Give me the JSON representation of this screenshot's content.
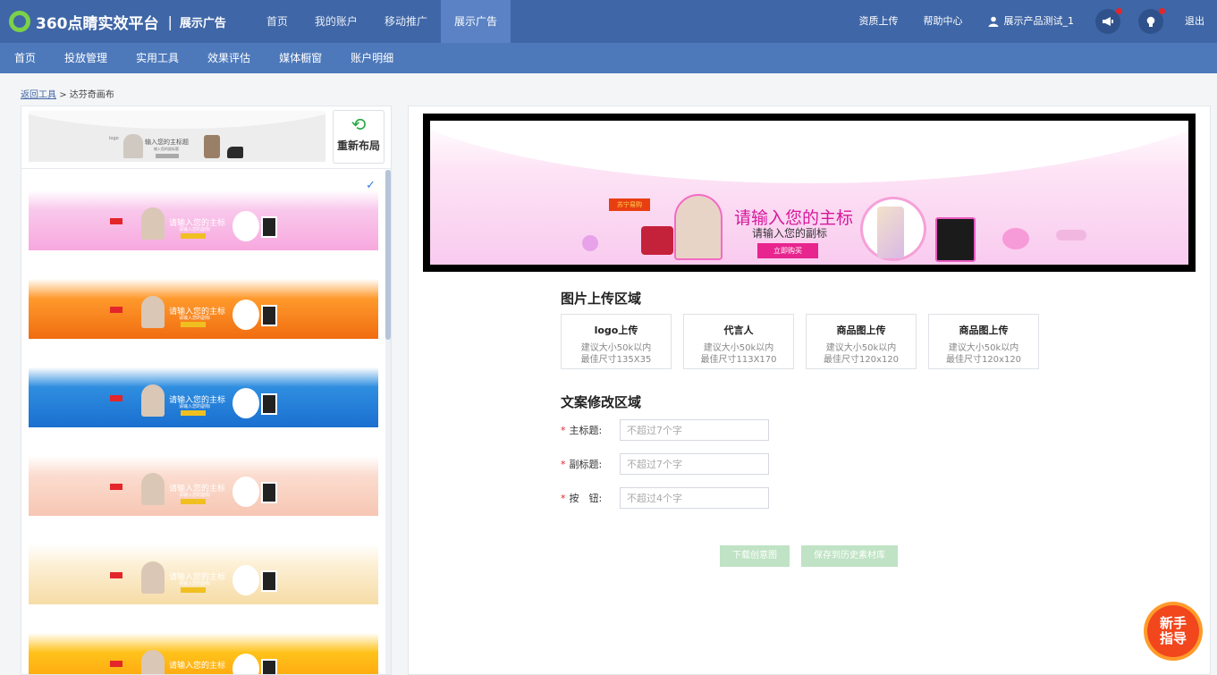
{
  "app": {
    "logo_text": "360点睛实效平台",
    "separator": "|",
    "section": "展示广告"
  },
  "top_nav": [
    {
      "label": "首页",
      "active": false
    },
    {
      "label": "我的账户",
      "active": false
    },
    {
      "label": "移动推广",
      "active": false
    },
    {
      "label": "展示广告",
      "active": true
    }
  ],
  "top_right": {
    "upload": "资质上传",
    "help": "帮助中心",
    "user": "展示产品测试_1",
    "logout": "退出"
  },
  "sub_nav": [
    "首页",
    "投放管理",
    "实用工具",
    "效果评估",
    "媒体橱窗",
    "账户明细"
  ],
  "breadcrumb": {
    "back": "返回工具",
    "sep": ">",
    "current": "达芬奇画布"
  },
  "left": {
    "preview": {
      "logo": "logo",
      "title": "输入您的主标题",
      "subtitle": "输入您的副标题"
    },
    "relayout_label": "重新布局",
    "templates": [
      {
        "title": "请输入您的主标",
        "subtitle": "请输入您的副标",
        "bg": "#f9c8ec",
        "wave": "#f7a8de",
        "selected": true
      },
      {
        "title": "请输入您的主标",
        "subtitle": "请输入您的副标",
        "bg": "#ff9a2c",
        "wave": "#f06d10",
        "selected": false
      },
      {
        "title": "请输入您的主标",
        "subtitle": "请输入您的副标",
        "bg": "#2f8ee0",
        "wave": "#1a6fd0",
        "selected": false
      },
      {
        "title": "请输入您的主标",
        "subtitle": "请输入您的副标",
        "bg": "#fbdccf",
        "wave": "#f7c6b3",
        "selected": false
      },
      {
        "title": "请输入您的主标",
        "subtitle": "请输入您的副标",
        "bg": "#fdf0d6",
        "wave": "#f6dca6",
        "selected": false
      },
      {
        "title": "请输入您的主标",
        "subtitle": "",
        "bg": "#ffc21a",
        "wave": "#ff9a0a",
        "selected": false
      }
    ]
  },
  "banner": {
    "brand": "苏宁易购",
    "title": "请输入您的主标",
    "subtitle": "请输入您的副标",
    "button": "立即购买"
  },
  "upload_section": {
    "title": "图片上传区域",
    "cards": [
      {
        "title": "logo上传",
        "hint1": "建议大小50k以内",
        "hint2": "最佳尺寸135X35"
      },
      {
        "title": "代言人",
        "hint1": "建议大小50k以内",
        "hint2": "最佳尺寸113X170"
      },
      {
        "title": "商品图上传",
        "hint1": "建议大小50k以内",
        "hint2": "最佳尺寸120x120"
      },
      {
        "title": "商品图上传",
        "hint1": "建议大小50k以内",
        "hint2": "最佳尺寸120x120"
      }
    ]
  },
  "copy_section": {
    "title": "文案修改区域",
    "fields": [
      {
        "label": "主标题:",
        "placeholder": "不超过7个字"
      },
      {
        "label": "副标题:",
        "placeholder": "不超过7个字"
      },
      {
        "label": "按　钮:",
        "placeholder": "不超过4个字"
      }
    ]
  },
  "actions": {
    "download": "下载创意图",
    "save": "保存到历史素材库"
  },
  "guide": {
    "line1": "新手",
    "line2": "指导"
  }
}
